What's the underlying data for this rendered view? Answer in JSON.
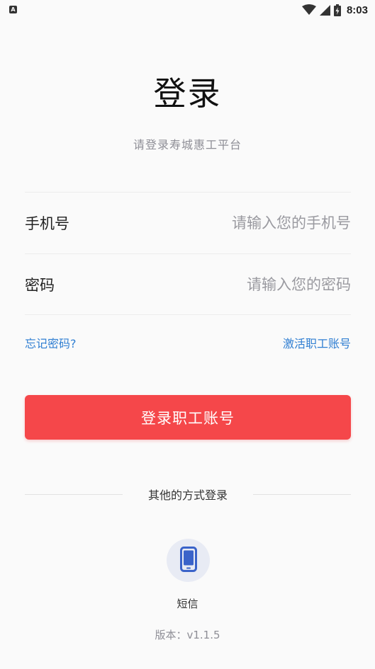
{
  "status_bar": {
    "notification_icon": "A",
    "icons": [
      "wifi-icon",
      "signal-icon",
      "battery-charging-icon"
    ],
    "time": "8:03"
  },
  "header": {
    "title": "登录",
    "subtitle": "请登录寿城惠工平台"
  },
  "form": {
    "phone": {
      "label": "手机号",
      "placeholder": "请输入您的手机号",
      "value": ""
    },
    "password": {
      "label": "密码",
      "placeholder": "请输入您的密码",
      "value": ""
    }
  },
  "links": {
    "forgot_password": "忘记密码?",
    "activate_account": "激活职工账号"
  },
  "login_button": {
    "label": "登录职工账号"
  },
  "other_login": {
    "title": "其他的方式登录",
    "sms": {
      "label": "短信",
      "icon": "smartphone-icon"
    }
  },
  "footer": {
    "version_label": "版本：",
    "version": "v1.1.5"
  },
  "colors": {
    "accent": "#f5474a",
    "link": "#2f7ed2",
    "sms_icon": "#3a63c9",
    "sms_bg": "#e8ebf4"
  }
}
